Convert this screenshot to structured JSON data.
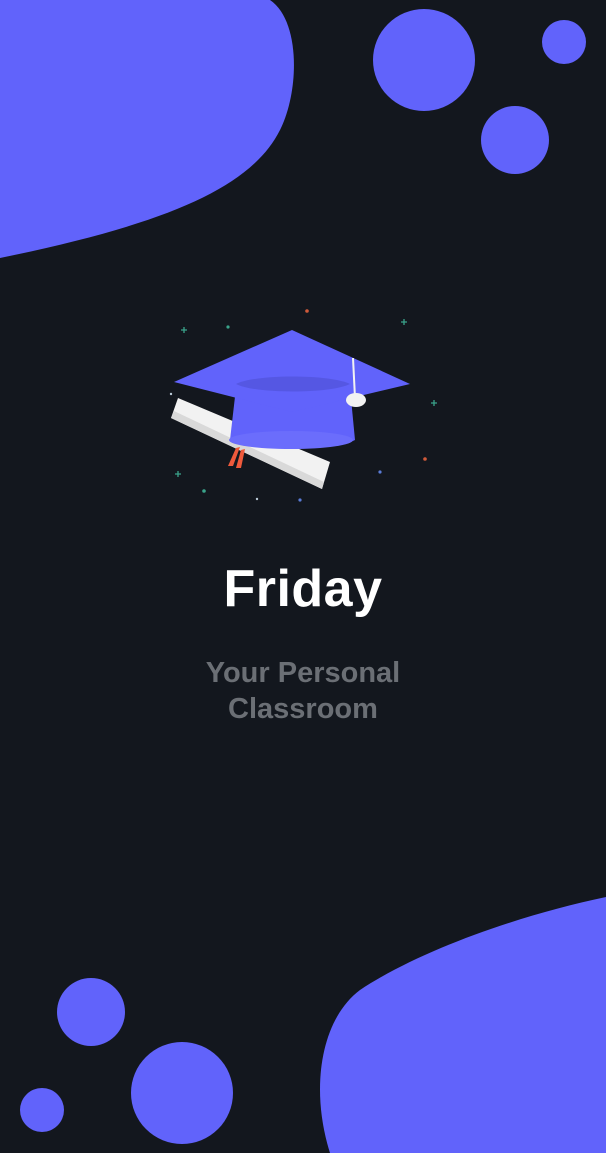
{
  "app": {
    "title": "Friday",
    "tagline_line1": "Your Personal",
    "tagline_line2": "Classroom"
  },
  "illustration": {
    "icon": "graduation-cap-with-diploma"
  },
  "colors": {
    "background": "#13171e",
    "accent": "#6163fb",
    "title": "#ffffff",
    "tagline": "#6b6f75",
    "ribbon": "#ef5a3c"
  }
}
